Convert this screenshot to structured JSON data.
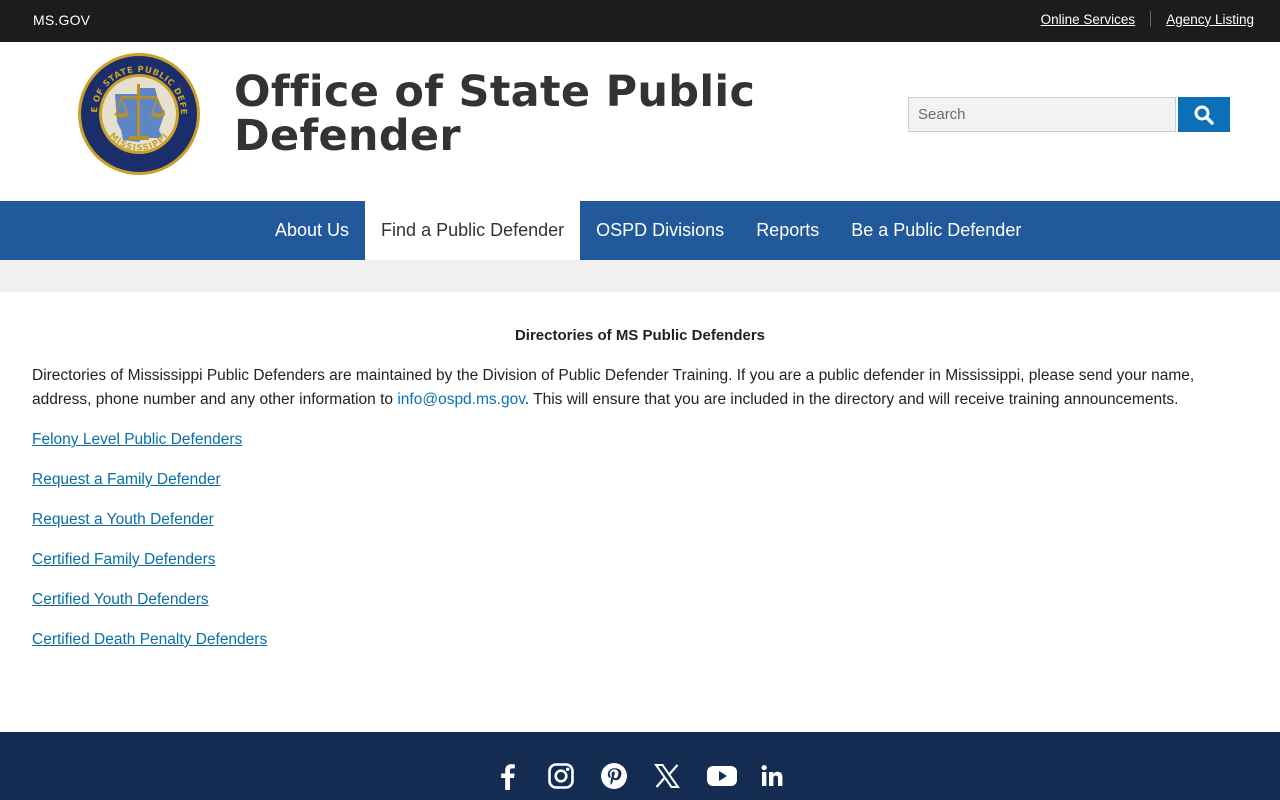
{
  "topbar": {
    "msgov": "MS.GOV",
    "online_services": "Online Services",
    "agency_listing": "Agency Listing"
  },
  "header": {
    "title": "Office of State Public Defender",
    "seal_text_top": "OFFICE OF STATE PUBLIC DEFENDER",
    "seal_text_bottom": "MISSISSIPPI",
    "search_placeholder": "Search"
  },
  "nav": {
    "items": [
      {
        "label": "About Us"
      },
      {
        "label": "Find a Public Defender",
        "active": true
      },
      {
        "label": "OSPD Divisions"
      },
      {
        "label": "Reports"
      },
      {
        "label": "Be a Public Defender"
      }
    ]
  },
  "main": {
    "heading": "Directories of MS Public Defenders",
    "intro_before": "Directories of Mississippi Public Defenders are maintained by the Division of Public Defender Training. If you are a public defender in Mississippi, please send your name, address, phone number and any other information to ",
    "intro_email": "info@ospd.ms.gov",
    "intro_after": ". This will ensure that you are included in the directory and will receive training announcements.",
    "links": [
      "Felony Level Public Defenders",
      "Request a Family Defender",
      "Request a Youth Defender",
      "Certified Family Defenders",
      "Certified Youth Defenders",
      "Certified Death Penalty Defenders"
    ]
  },
  "footer": {
    "social_icons": [
      "facebook-icon",
      "instagram-icon",
      "pinterest-icon",
      "x-icon",
      "youtube-icon",
      "linkedin-icon"
    ]
  },
  "colors": {
    "topbar": "#1c1c1c",
    "nav": "#21599a",
    "search_button": "#0b70b8",
    "link": "#0b6ea7",
    "footer": "#142c52"
  }
}
